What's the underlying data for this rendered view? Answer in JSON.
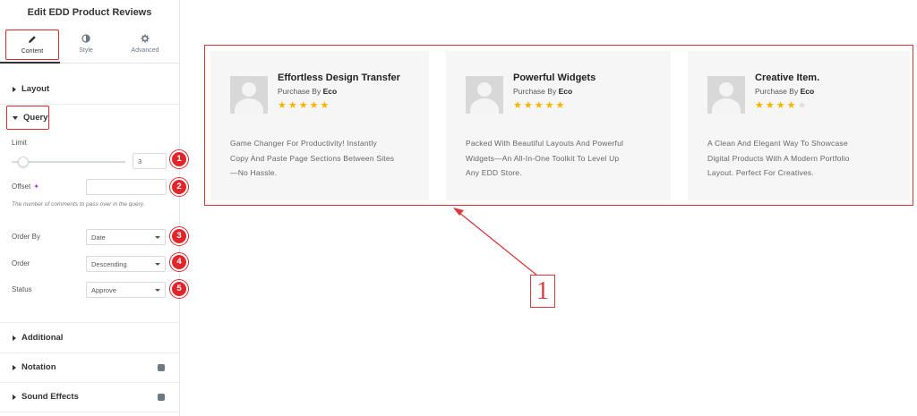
{
  "panel": {
    "title": "Edit EDD Product Reviews",
    "tabs": [
      {
        "label": "Content",
        "icon": "pencil-icon",
        "active": true
      },
      {
        "label": "Style",
        "icon": "contrast-icon"
      },
      {
        "label": "Advanced",
        "icon": "gear-icon"
      }
    ],
    "sections": {
      "layout": "Layout",
      "query": "Query",
      "additional": "Additional",
      "notation": "Notation",
      "sound_effects": "Sound Effects"
    },
    "query": {
      "limit_label": "Limit",
      "limit_value": "3",
      "limit_slider_fraction": 0.1,
      "offset_label": "Offset",
      "offset_value": "",
      "offset_help": "The number of comments to pass over in the query.",
      "order_by_label": "Order By",
      "order_by_value": "Date",
      "order_label": "Order",
      "order_value": "Descending",
      "status_label": "Status",
      "status_value": "Approve"
    },
    "badges": [
      "1",
      "2",
      "3",
      "4",
      "5"
    ]
  },
  "preview": {
    "cards": [
      {
        "title": "Effortless Design Transfer",
        "purchase_prefix": "Purchase By",
        "purchaser": "Eco",
        "rating": 5,
        "max_rating": 5,
        "text_lines": [
          "Game Changer For Productivity! Instantly",
          "Copy And Paste Page Sections Between Sites",
          "—No Hassle."
        ]
      },
      {
        "title": "Powerful Widgets",
        "purchase_prefix": "Purchase By",
        "purchaser": "Eco",
        "rating": 5,
        "max_rating": 5,
        "text_lines": [
          "Packed With Beautiful Layouts And Powerful",
          "Widgets—An All-In-One Toolkit To Level Up",
          "Any EDD Store."
        ]
      },
      {
        "title": "Creative Item.",
        "purchase_prefix": "Purchase By",
        "purchaser": "Eco",
        "rating": 4,
        "max_rating": 5,
        "text_lines": [
          "A Clean And Elegant Way To Showcase",
          "Digital Products With A Modern Portfolio",
          "Layout. Perfect For Creatives."
        ]
      }
    ],
    "callout_number": "1"
  },
  "colors": {
    "annotation_red": "#d93a3f",
    "badge_red": "#e0262b",
    "star_gold": "#f4b400",
    "card_bg": "#f6f6f6"
  }
}
